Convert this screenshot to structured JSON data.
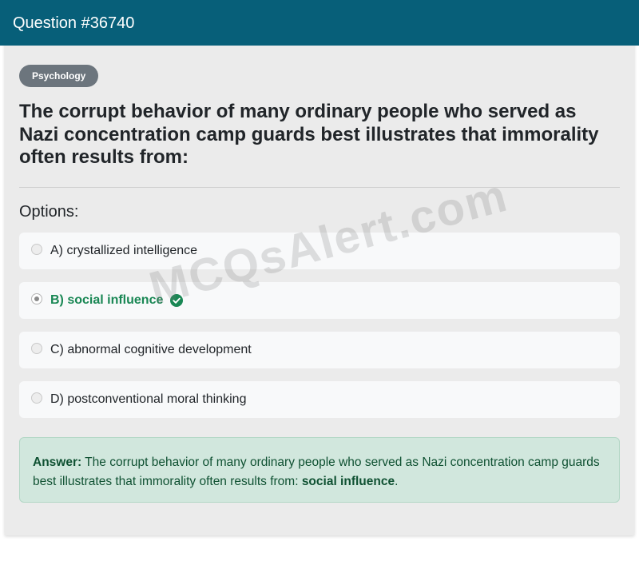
{
  "header": {
    "title": "Question #36740"
  },
  "category": "Psychology",
  "question": "The corrupt behavior of many ordinary people who served as Nazi concentration camp guards best illustrates that immorality often results from:",
  "options_label": "Options:",
  "options": [
    {
      "label": "A) crystallized intelligence",
      "selected": false,
      "correct": false
    },
    {
      "label": "B) social influence",
      "selected": true,
      "correct": true
    },
    {
      "label": "C) abnormal cognitive development",
      "selected": false,
      "correct": false
    },
    {
      "label": "D) postconventional moral thinking",
      "selected": false,
      "correct": false
    }
  ],
  "answer": {
    "prefix": "Answer:",
    "text": " The corrupt behavior of many ordinary people who served as Nazi concentration camp guards best illustrates that immorality often results from: ",
    "highlight": "social influence",
    "suffix": "."
  },
  "watermark": "MCQsAlert.com",
  "icons": {
    "correct": "check-circle-icon"
  },
  "colors": {
    "header_bg": "#075f79",
    "badge_bg": "#6c757d",
    "correct": "#198754",
    "answer_bg": "#d1e7dd"
  }
}
